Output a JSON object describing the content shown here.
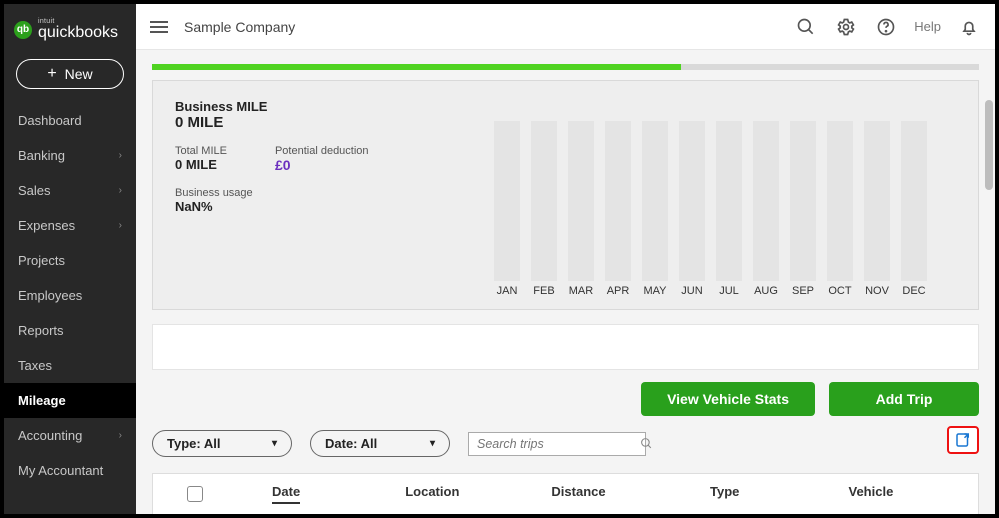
{
  "brand": {
    "small": "intuit",
    "name": "quickbooks",
    "icon_letters": "qb"
  },
  "new_button": "New",
  "nav": [
    {
      "label": "Dashboard",
      "expandable": false,
      "active": false
    },
    {
      "label": "Banking",
      "expandable": true,
      "active": false
    },
    {
      "label": "Sales",
      "expandable": true,
      "active": false
    },
    {
      "label": "Expenses",
      "expandable": true,
      "active": false
    },
    {
      "label": "Projects",
      "expandable": false,
      "active": false
    },
    {
      "label": "Employees",
      "expandable": false,
      "active": false
    },
    {
      "label": "Reports",
      "expandable": false,
      "active": false
    },
    {
      "label": "Taxes",
      "expandable": false,
      "active": false
    },
    {
      "label": "Mileage",
      "expandable": false,
      "active": true
    },
    {
      "label": "Accounting",
      "expandable": true,
      "active": false
    },
    {
      "label": "My Accountant",
      "expandable": false,
      "active": false
    }
  ],
  "topbar": {
    "company": "Sample Company",
    "help": "Help"
  },
  "summary": {
    "business_label": "Business MILE",
    "business_value": "0 MILE",
    "total_label": "Total MILE",
    "total_value": "0 MILE",
    "deduction_label": "Potential deduction",
    "deduction_value": "£0",
    "usage_label": "Business usage",
    "usage_value": "NaN%"
  },
  "chart_data": {
    "type": "bar",
    "categories": [
      "JAN",
      "FEB",
      "MAR",
      "APR",
      "MAY",
      "JUN",
      "JUL",
      "AUG",
      "SEP",
      "OCT",
      "NOV",
      "DEC"
    ],
    "values": [
      0,
      0,
      0,
      0,
      0,
      0,
      0,
      0,
      0,
      0,
      0,
      0
    ],
    "title": "",
    "xlabel": "",
    "ylabel": "",
    "ylim": [
      0,
      1
    ]
  },
  "progress_percent": 64,
  "buttons": {
    "view_stats": "View Vehicle Stats",
    "add_trip": "Add Trip"
  },
  "filters": {
    "type_label": "Type: All",
    "date_label": "Date: All",
    "search_placeholder": "Search trips"
  },
  "table": {
    "columns": [
      "Date",
      "Location",
      "Distance",
      "Type",
      "Vehicle"
    ],
    "sorted_column": "Date"
  }
}
